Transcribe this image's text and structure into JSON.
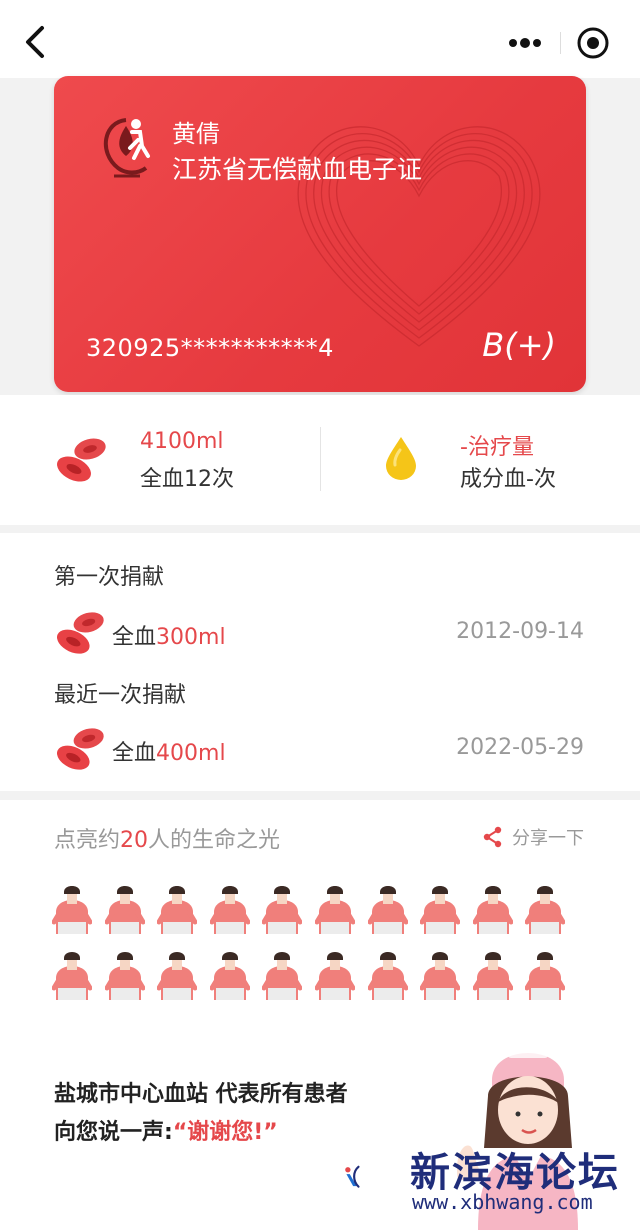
{
  "card": {
    "name": "黄倩",
    "title": "江苏省无偿献血电子证",
    "id_number": "320925***********4",
    "blood_type": "B(+)"
  },
  "stats": {
    "whole_blood_volume": "4100ml",
    "whole_blood_count": "全血12次",
    "component_volume": "-治疗量",
    "component_count": "成分血-次"
  },
  "donations": {
    "first": {
      "title": "第一次捐献",
      "type": "全血",
      "amount": "300ml",
      "date": "2012-09-14"
    },
    "latest": {
      "title": "最近一次捐献",
      "type": "全血",
      "amount": "400ml",
      "date": "2022-05-29"
    }
  },
  "life": {
    "title_prefix": "点亮约",
    "count": "20",
    "title_suffix": "人的生命之光",
    "share_label": "分享一下",
    "people_count": 20
  },
  "thanks": {
    "line1": "盐城市中心血站 代表所有患者",
    "line2_prefix": "向您说一声:",
    "line2_quote": "“谢谢您!”"
  },
  "watermark": {
    "text": "新滨海论坛",
    "url": "www.xbhwang.com"
  },
  "colors": {
    "accent": "#e5484b",
    "card_red": "#e63a3f",
    "plasma_yellow": "#f5c518"
  }
}
